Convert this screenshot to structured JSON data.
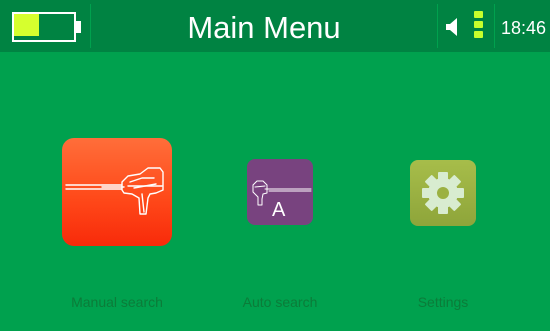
{
  "header": {
    "title": "Main Menu",
    "time": "18:46",
    "battery_level": 0.45,
    "signal_bars": 3
  },
  "menu": [
    {
      "id": "manual",
      "label": "Manual search",
      "icon": "manual-detector-icon",
      "selected": true
    },
    {
      "id": "auto",
      "label": "Auto search",
      "icon": "auto-detector-icon",
      "selected": false
    },
    {
      "id": "settings",
      "label": "Settings",
      "icon": "gear-icon",
      "selected": false
    }
  ],
  "icons": {
    "auto_letter": "A"
  },
  "colors": {
    "background": "#00a14e",
    "header": "#008342",
    "manual_tile": "#ff4a1a",
    "auto_tile": "#78437f",
    "settings_tile": "#9bb142",
    "battery_fill": "#d6ff2e"
  }
}
